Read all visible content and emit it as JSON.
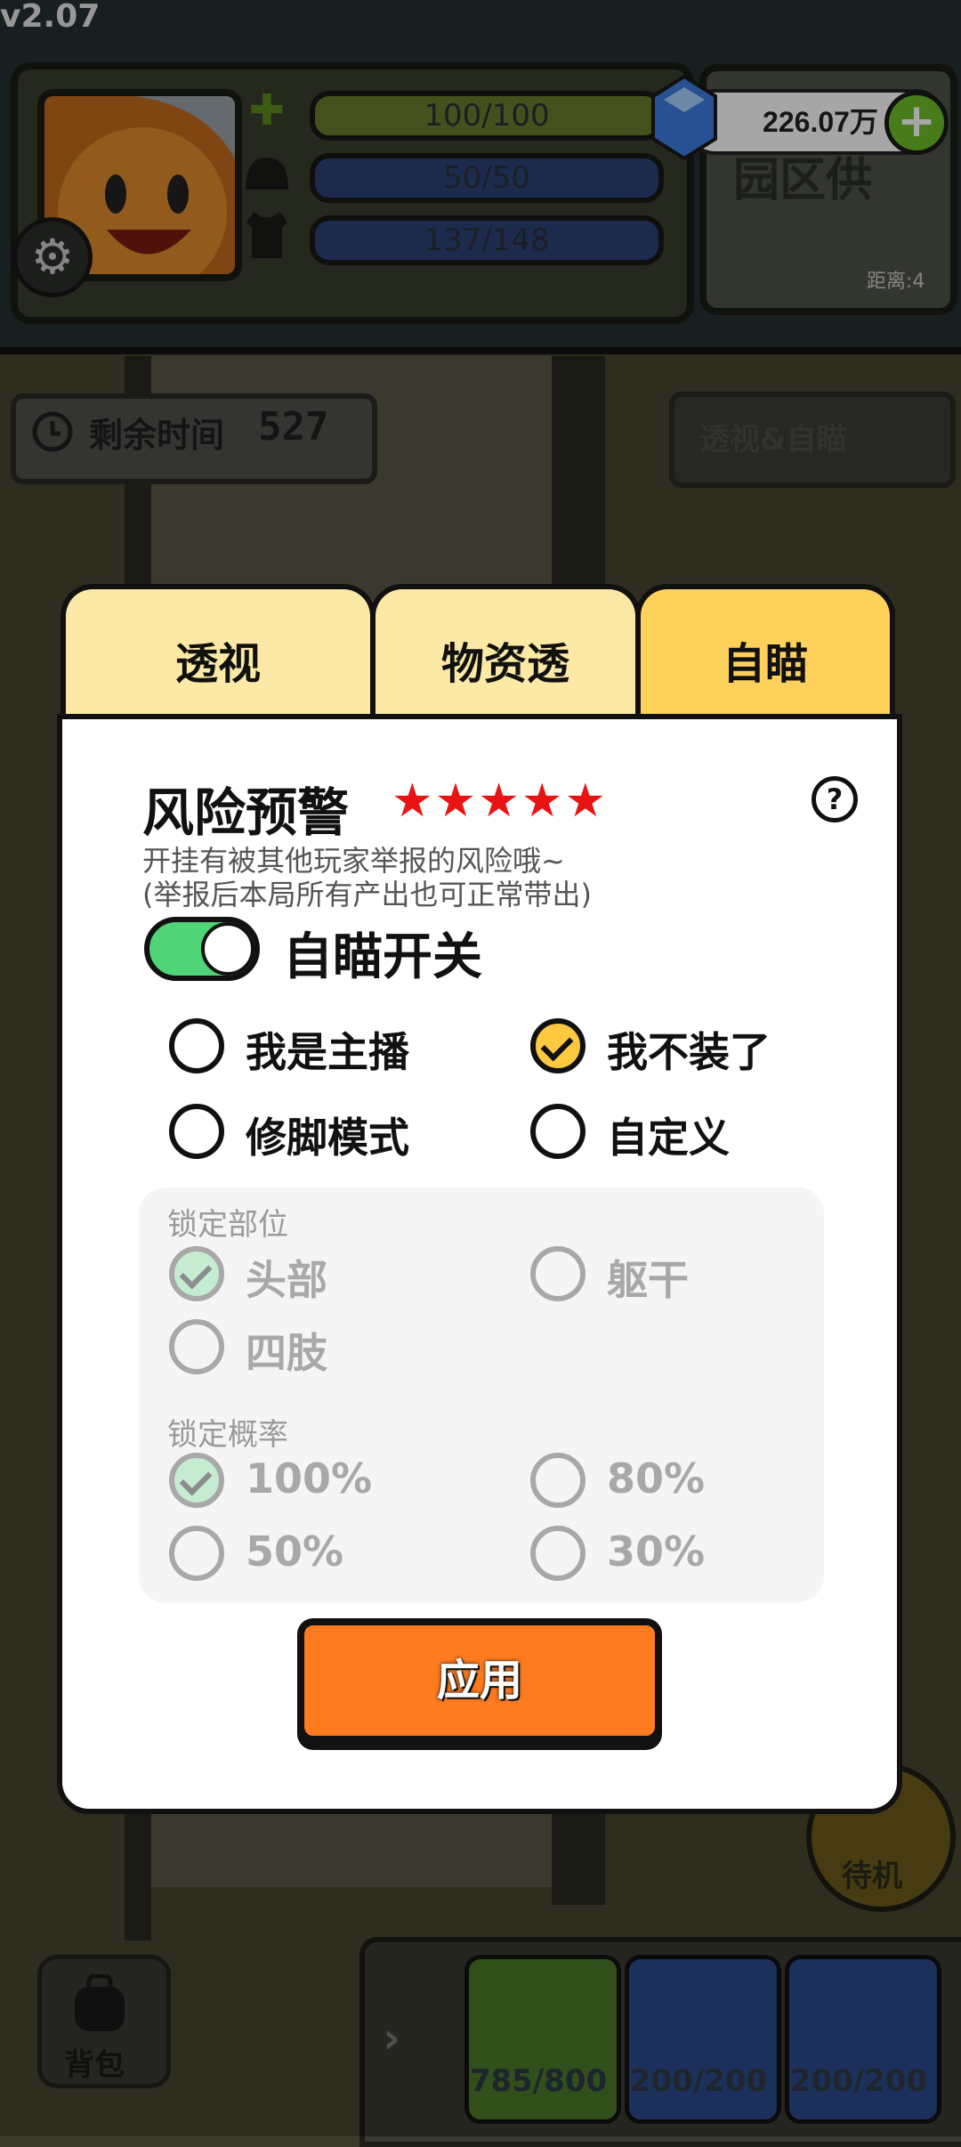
{
  "version": "v2.07",
  "hud": {
    "hp": "100/100",
    "helmet": "50/50",
    "armor": "137/148",
    "gems": "226.07万",
    "minimap_text": "园区供",
    "distance": "距离:4"
  },
  "timer": {
    "label": "剩余时间",
    "value": "527"
  },
  "xray_button": "透视&自瞄",
  "tabs": [
    "透视",
    "物资透",
    "自瞄"
  ],
  "active_tab": "自瞄",
  "modal": {
    "title": "风险预警",
    "stars": "★★★★★",
    "warning_line1": "开挂有被其他玩家举报的风险哦~",
    "warning_line2": "(举报后本局所有产出也可正常带出)",
    "toggle_label": "自瞄开关",
    "toggle_on": true,
    "modes": [
      {
        "label": "我是主播",
        "checked": false
      },
      {
        "label": "我不装了",
        "checked": true
      },
      {
        "label": "修脚模式",
        "checked": false
      },
      {
        "label": "自定义",
        "checked": false
      }
    ],
    "lock_part_label": "锁定部位",
    "lock_parts": [
      {
        "label": "头部",
        "checked": true
      },
      {
        "label": "躯干",
        "checked": false
      },
      {
        "label": "四肢",
        "checked": false
      }
    ],
    "lock_rate_label": "锁定概率",
    "lock_rates": [
      {
        "label": "100%",
        "checked": true
      },
      {
        "label": "80%",
        "checked": false
      },
      {
        "label": "50%",
        "checked": false
      },
      {
        "label": "30%",
        "checked": false
      }
    ],
    "apply_label": "应用"
  },
  "bottom": {
    "bag_label": "背包",
    "standby_label": "待机",
    "items": [
      "785/800",
      "200/200",
      "200/200"
    ]
  },
  "colors": {
    "tab_active": "#fdd15a",
    "tab_inactive": "#fde9a6",
    "toggle_on": "#4fd477",
    "check_fill": "#fcc940",
    "apply": "#ff7b20",
    "stars": "#e81414"
  }
}
